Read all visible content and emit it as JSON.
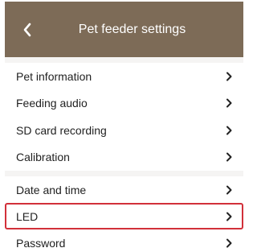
{
  "header": {
    "title": "Pet feeder settings",
    "back_icon": "chevron-left-icon",
    "bg_color": "#7d6b57"
  },
  "sections": [
    {
      "items": [
        {
          "label": "Pet information",
          "icon": "chevron-right-icon"
        },
        {
          "label": "Feeding audio",
          "icon": "chevron-right-icon"
        },
        {
          "label": "SD card recording",
          "icon": "chevron-right-icon"
        },
        {
          "label": "Calibration",
          "icon": "chevron-right-icon"
        }
      ]
    },
    {
      "items": [
        {
          "label": "Date and time",
          "icon": "chevron-right-icon"
        },
        {
          "label": "LED",
          "icon": "chevron-right-icon",
          "highlighted": true
        },
        {
          "label": "Password",
          "icon": "chevron-right-icon"
        }
      ]
    }
  ],
  "highlight_color": "#d2303a"
}
